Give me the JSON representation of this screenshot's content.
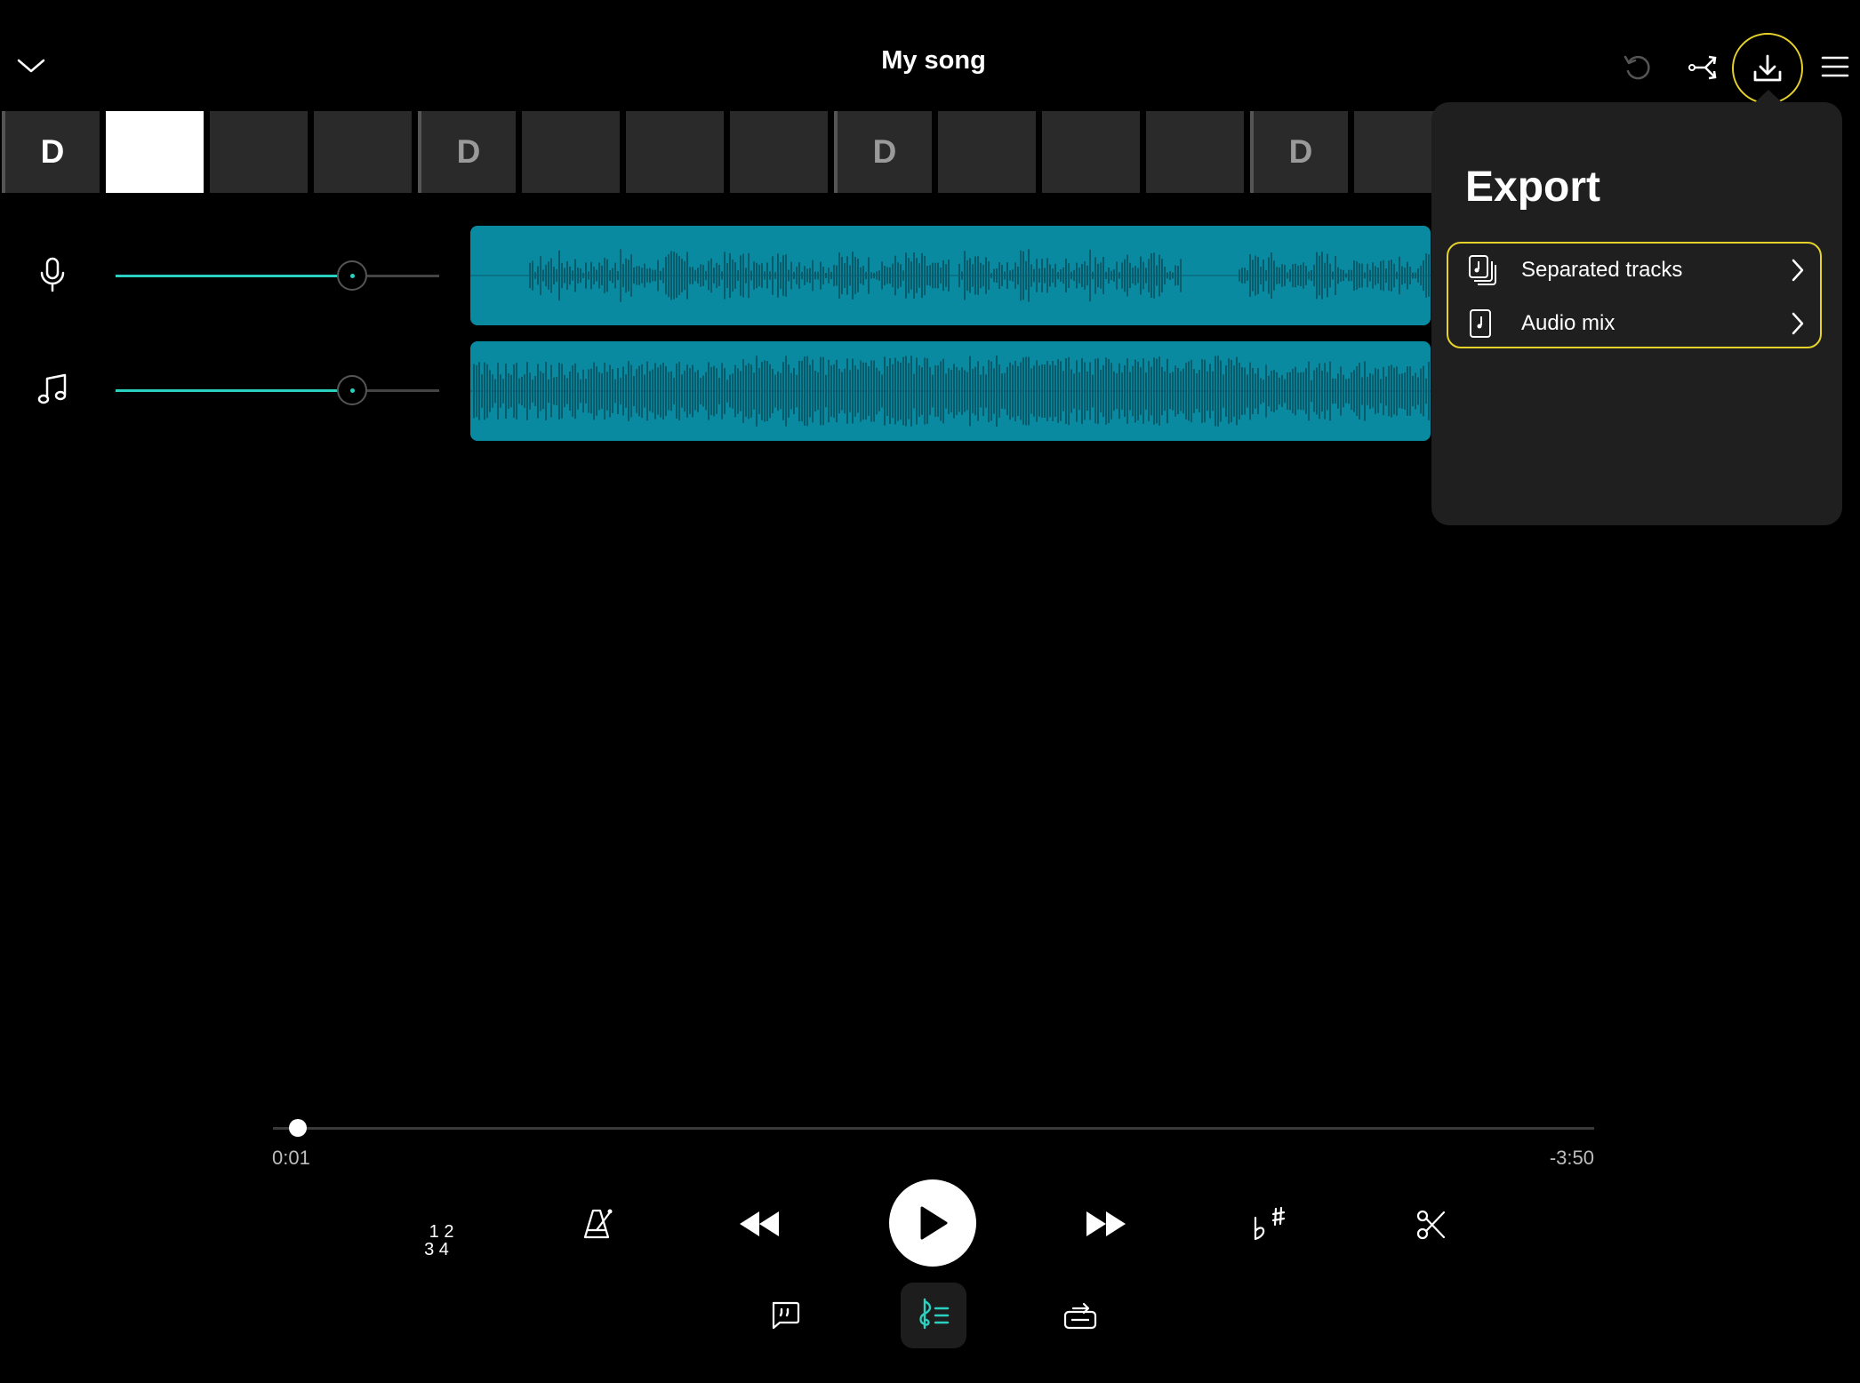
{
  "header": {
    "title": "My song",
    "icons": [
      "chevron-down-icon",
      "undo-icon",
      "share-icon",
      "download-icon",
      "menu-icon"
    ]
  },
  "chords": [
    {
      "label": "D",
      "bar_start": true,
      "current": true,
      "active": false
    },
    {
      "label": "",
      "bar_start": false,
      "current": false,
      "active": true
    },
    {
      "label": "",
      "bar_start": false,
      "current": false,
      "active": false
    },
    {
      "label": "",
      "bar_start": false,
      "current": false,
      "active": false
    },
    {
      "label": "D",
      "bar_start": true,
      "current": false,
      "active": false
    },
    {
      "label": "",
      "bar_start": false,
      "current": false,
      "active": false
    },
    {
      "label": "",
      "bar_start": false,
      "current": false,
      "active": false
    },
    {
      "label": "",
      "bar_start": false,
      "current": false,
      "active": false
    },
    {
      "label": "D",
      "bar_start": true,
      "current": false,
      "active": false
    },
    {
      "label": "",
      "bar_start": false,
      "current": false,
      "active": false
    },
    {
      "label": "",
      "bar_start": false,
      "current": false,
      "active": false
    },
    {
      "label": "",
      "bar_start": false,
      "current": false,
      "active": false
    },
    {
      "label": "D",
      "bar_start": true,
      "current": false,
      "active": false
    },
    {
      "label": "",
      "bar_start": false,
      "current": false,
      "active": false
    }
  ],
  "tracks": [
    {
      "icon": "microphone-icon",
      "volume": 0.73
    },
    {
      "icon": "music-note-icon",
      "volume": 0.73
    }
  ],
  "export": {
    "title": "Export",
    "options": [
      {
        "label": "Separated tracks",
        "icon": "separated-tracks-icon"
      },
      {
        "label": "Audio mix",
        "icon": "audio-file-icon"
      }
    ]
  },
  "playback": {
    "elapsed": "0:01",
    "remaining": "-3:50",
    "progress": 0.011
  },
  "controls": {
    "count_in_label": "1 2\n3 4",
    "icons": [
      "count-in-icon",
      "metronome-icon",
      "rewind-icon",
      "play-icon",
      "fast-forward-icon",
      "transpose-icon",
      "scissors-icon",
      "lyrics-icon",
      "chords-icon",
      "loop-icon"
    ]
  },
  "colors": {
    "accent": "#2ad0c0",
    "highlight": "#e6d22a",
    "waveform": "#0a8aa0",
    "waveform_dark": "#075b6b"
  }
}
